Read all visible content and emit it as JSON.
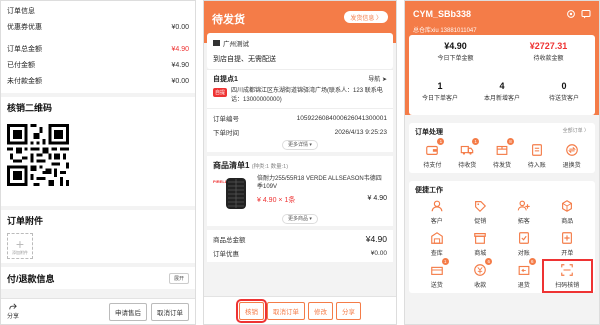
{
  "order_detail": {
    "section_title": "订单信息",
    "rows": [
      {
        "label": "优惠券优惠",
        "value": "¥0.00",
        "red": false
      },
      {
        "label": "订单总金额",
        "value": "¥4.90",
        "red": true
      },
      {
        "label": "已付金额",
        "value": "¥4.90",
        "red": false
      },
      {
        "label": "未付款金额",
        "value": "¥0.00",
        "red": false
      }
    ],
    "qr_title": "核销二维码",
    "attachment_title": "订单附件",
    "upload_label": "添加附件",
    "refund_title": "付/退款信息",
    "expand_label": "展开",
    "share_label": "分享",
    "apply_after_sale": "申请售后",
    "cancel_order": "取消订单"
  },
  "pending": {
    "title": "待发货",
    "info_btn": "发货信息 〉",
    "store_name": "广州测试",
    "ship_mode": "到店自提、无需配送",
    "pickup_name": "自提点1",
    "nav_label": "导航",
    "self_tag": "自提",
    "address": "四川成都锦江区东湖街道锦驿湾广场(联系人：123 联系电话：13000000000)",
    "order_no_label": "订单编号",
    "order_no": "1059226084000626041300001",
    "order_time_label": "下单时间",
    "order_time": "2026/4/13 9:25:23",
    "more_details": "更多详情 ▾",
    "goods_title": "商品清单1",
    "goods_sub": "(种类:1 数量:1)",
    "brand": "PIRELLI",
    "goods_name": "倍耐力255/55R18 VERDE ALLSEASON韦德四季109V",
    "goods_price_qty": "¥ 4.90 × 1条",
    "goods_subtotal": "¥ 4.90",
    "more_goods": "更多商品 ▾",
    "total_label": "商品总金额",
    "total_value": "¥4.90",
    "discount_label": "订单优惠",
    "discount_value": "¥0.00",
    "btn_verify": "核销",
    "btn_cancel": "取消订单",
    "btn_edit": "修改",
    "btn_share": "分享"
  },
  "dashboard": {
    "name": "CYM_SBb338",
    "sub": "总仓库xiu   13881011047",
    "stats_top": [
      {
        "value": "¥4.90",
        "label": "今日下单金额",
        "red": false
      },
      {
        "value": "¥2727.31",
        "label": "待收款金额",
        "red": true
      }
    ],
    "stats_bottom": [
      {
        "value": "1",
        "label": "今日下单客户"
      },
      {
        "value": "4",
        "label": "本月新增客户"
      },
      {
        "value": "0",
        "label": "待送货客户"
      }
    ],
    "order_section": "订单处理",
    "all_orders": "全部订单 〉",
    "order_items": [
      {
        "label": "待支付",
        "badge": "1",
        "icon": "wallet-icon"
      },
      {
        "label": "待收货",
        "badge": "1",
        "icon": "truck-icon"
      },
      {
        "label": "待发货",
        "badge": "8",
        "icon": "box-icon"
      },
      {
        "label": "待入账",
        "badge": "",
        "icon": "ledger-icon"
      },
      {
        "label": "退换货",
        "badge": "",
        "icon": "exchange-icon"
      }
    ],
    "quick_section": "便捷工作",
    "quick_items": [
      {
        "label": "客户",
        "badge": "",
        "icon": "customer-icon"
      },
      {
        "label": "促销",
        "badge": "",
        "icon": "promo-icon"
      },
      {
        "label": "拓客",
        "badge": "",
        "icon": "expand-icon"
      },
      {
        "label": "商品",
        "badge": "",
        "icon": "goods-icon"
      },
      {
        "label": "查库",
        "badge": "",
        "icon": "warehouse-icon"
      },
      {
        "label": "商城",
        "badge": "",
        "icon": "mall-icon"
      },
      {
        "label": "对账",
        "badge": "",
        "icon": "reconcile-icon"
      },
      {
        "label": "开单",
        "badge": "",
        "icon": "invoice-icon"
      },
      {
        "label": "送货",
        "badge": "1",
        "icon": "delivery-icon"
      },
      {
        "label": "收款",
        "badge": "6",
        "icon": "payment-icon"
      },
      {
        "label": "退货",
        "badge": "6",
        "icon": "return-icon"
      },
      {
        "label": "扫码核销",
        "badge": "",
        "icon": "scan-icon"
      }
    ],
    "accent": "#f47c48"
  }
}
